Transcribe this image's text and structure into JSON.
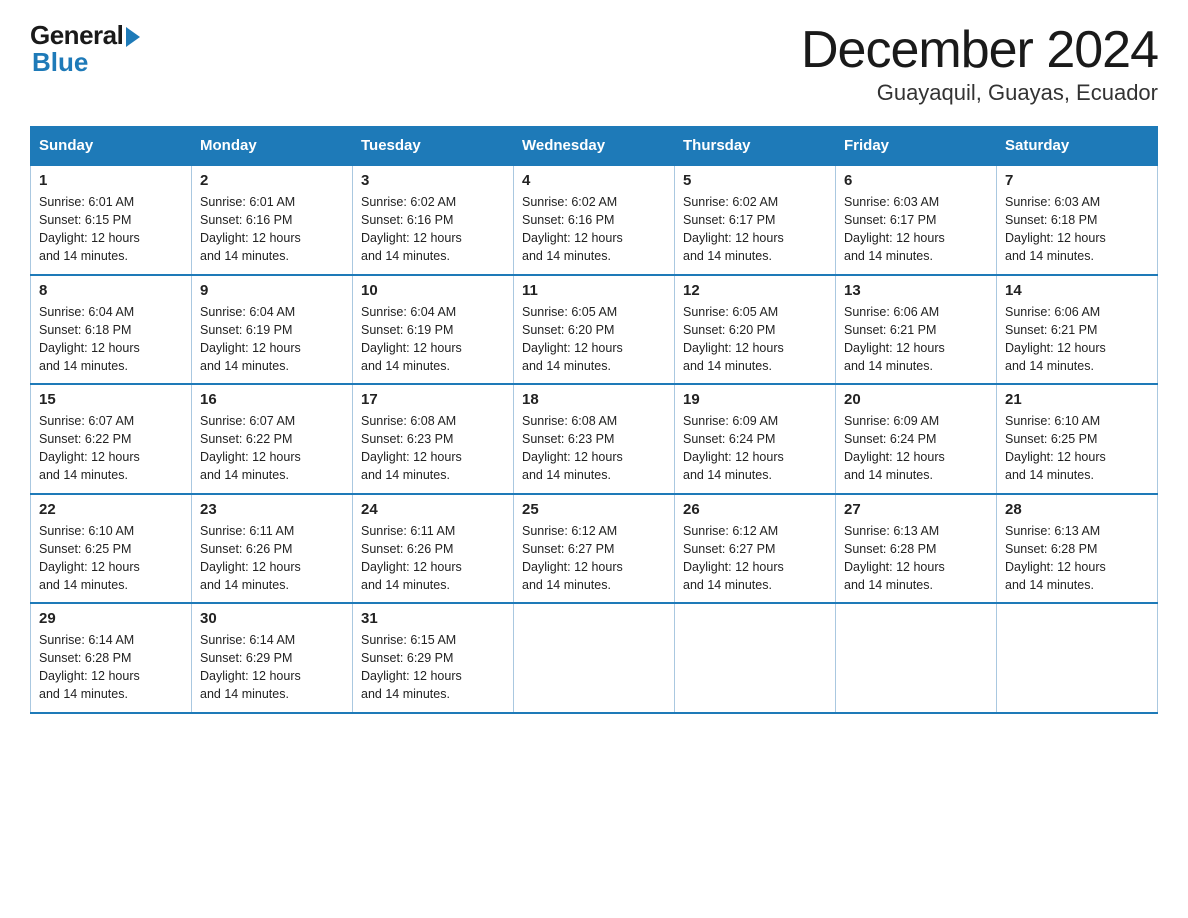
{
  "header": {
    "logo_general": "General",
    "logo_blue": "Blue",
    "month_title": "December 2024",
    "subtitle": "Guayaquil, Guayas, Ecuador"
  },
  "calendar": {
    "days": [
      "Sunday",
      "Monday",
      "Tuesday",
      "Wednesday",
      "Thursday",
      "Friday",
      "Saturday"
    ],
    "weeks": [
      [
        {
          "num": "1",
          "sunrise": "6:01 AM",
          "sunset": "6:15 PM",
          "daylight": "12 hours and 14 minutes."
        },
        {
          "num": "2",
          "sunrise": "6:01 AM",
          "sunset": "6:16 PM",
          "daylight": "12 hours and 14 minutes."
        },
        {
          "num": "3",
          "sunrise": "6:02 AM",
          "sunset": "6:16 PM",
          "daylight": "12 hours and 14 minutes."
        },
        {
          "num": "4",
          "sunrise": "6:02 AM",
          "sunset": "6:16 PM",
          "daylight": "12 hours and 14 minutes."
        },
        {
          "num": "5",
          "sunrise": "6:02 AM",
          "sunset": "6:17 PM",
          "daylight": "12 hours and 14 minutes."
        },
        {
          "num": "6",
          "sunrise": "6:03 AM",
          "sunset": "6:17 PM",
          "daylight": "12 hours and 14 minutes."
        },
        {
          "num": "7",
          "sunrise": "6:03 AM",
          "sunset": "6:18 PM",
          "daylight": "12 hours and 14 minutes."
        }
      ],
      [
        {
          "num": "8",
          "sunrise": "6:04 AM",
          "sunset": "6:18 PM",
          "daylight": "12 hours and 14 minutes."
        },
        {
          "num": "9",
          "sunrise": "6:04 AM",
          "sunset": "6:19 PM",
          "daylight": "12 hours and 14 minutes."
        },
        {
          "num": "10",
          "sunrise": "6:04 AM",
          "sunset": "6:19 PM",
          "daylight": "12 hours and 14 minutes."
        },
        {
          "num": "11",
          "sunrise": "6:05 AM",
          "sunset": "6:20 PM",
          "daylight": "12 hours and 14 minutes."
        },
        {
          "num": "12",
          "sunrise": "6:05 AM",
          "sunset": "6:20 PM",
          "daylight": "12 hours and 14 minutes."
        },
        {
          "num": "13",
          "sunrise": "6:06 AM",
          "sunset": "6:21 PM",
          "daylight": "12 hours and 14 minutes."
        },
        {
          "num": "14",
          "sunrise": "6:06 AM",
          "sunset": "6:21 PM",
          "daylight": "12 hours and 14 minutes."
        }
      ],
      [
        {
          "num": "15",
          "sunrise": "6:07 AM",
          "sunset": "6:22 PM",
          "daylight": "12 hours and 14 minutes."
        },
        {
          "num": "16",
          "sunrise": "6:07 AM",
          "sunset": "6:22 PM",
          "daylight": "12 hours and 14 minutes."
        },
        {
          "num": "17",
          "sunrise": "6:08 AM",
          "sunset": "6:23 PM",
          "daylight": "12 hours and 14 minutes."
        },
        {
          "num": "18",
          "sunrise": "6:08 AM",
          "sunset": "6:23 PM",
          "daylight": "12 hours and 14 minutes."
        },
        {
          "num": "19",
          "sunrise": "6:09 AM",
          "sunset": "6:24 PM",
          "daylight": "12 hours and 14 minutes."
        },
        {
          "num": "20",
          "sunrise": "6:09 AM",
          "sunset": "6:24 PM",
          "daylight": "12 hours and 14 minutes."
        },
        {
          "num": "21",
          "sunrise": "6:10 AM",
          "sunset": "6:25 PM",
          "daylight": "12 hours and 14 minutes."
        }
      ],
      [
        {
          "num": "22",
          "sunrise": "6:10 AM",
          "sunset": "6:25 PM",
          "daylight": "12 hours and 14 minutes."
        },
        {
          "num": "23",
          "sunrise": "6:11 AM",
          "sunset": "6:26 PM",
          "daylight": "12 hours and 14 minutes."
        },
        {
          "num": "24",
          "sunrise": "6:11 AM",
          "sunset": "6:26 PM",
          "daylight": "12 hours and 14 minutes."
        },
        {
          "num": "25",
          "sunrise": "6:12 AM",
          "sunset": "6:27 PM",
          "daylight": "12 hours and 14 minutes."
        },
        {
          "num": "26",
          "sunrise": "6:12 AM",
          "sunset": "6:27 PM",
          "daylight": "12 hours and 14 minutes."
        },
        {
          "num": "27",
          "sunrise": "6:13 AM",
          "sunset": "6:28 PM",
          "daylight": "12 hours and 14 minutes."
        },
        {
          "num": "28",
          "sunrise": "6:13 AM",
          "sunset": "6:28 PM",
          "daylight": "12 hours and 14 minutes."
        }
      ],
      [
        {
          "num": "29",
          "sunrise": "6:14 AM",
          "sunset": "6:28 PM",
          "daylight": "12 hours and 14 minutes."
        },
        {
          "num": "30",
          "sunrise": "6:14 AM",
          "sunset": "6:29 PM",
          "daylight": "12 hours and 14 minutes."
        },
        {
          "num": "31",
          "sunrise": "6:15 AM",
          "sunset": "6:29 PM",
          "daylight": "12 hours and 14 minutes."
        },
        null,
        null,
        null,
        null
      ]
    ],
    "sunrise_label": "Sunrise:",
    "sunset_label": "Sunset:",
    "daylight_label": "Daylight:"
  }
}
